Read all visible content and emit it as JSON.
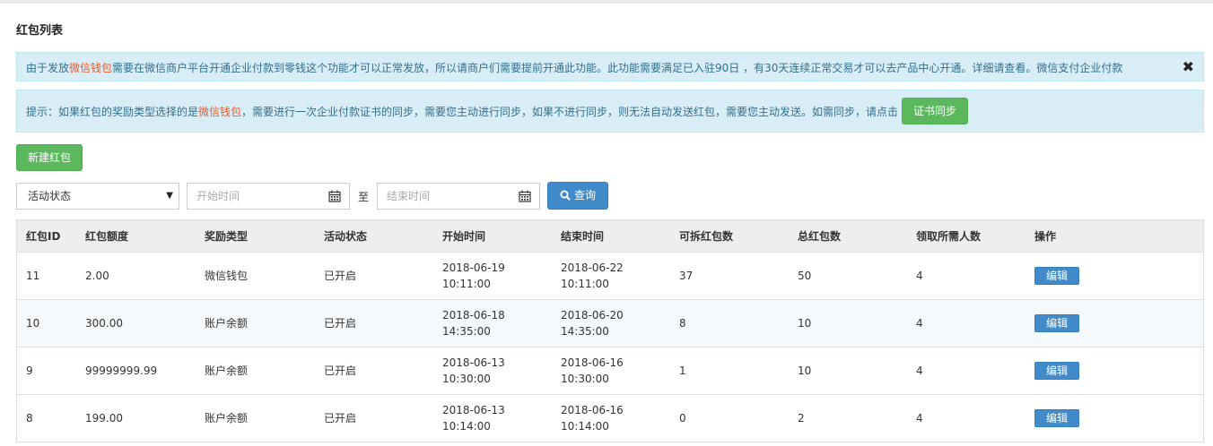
{
  "page_title": "红包列表",
  "alert1": {
    "prefix": "由于发放",
    "highlight": "微信钱包",
    "suffix": "需要在微信商户平台开通企业付款到零钱这个功能才可以正常发放，所以请商户们需要提前开通此功能。此功能需要满足已入驻90日 ，有30天连续正常交易才可以去产品中心开通。详细请查看。微信支付企业付款",
    "close": "✖"
  },
  "alert2": {
    "prefix": "提示：如果红包的奖励类型选择的是",
    "highlight": "微信钱包",
    "suffix": "，需要进行一次企业付款证书的同步，需要您主动进行同步，如果不进行同步，则无法自动发送红包，需要您主动发送。如需同步，请点击",
    "sync_button": "证书同步"
  },
  "new_button": "新建红包",
  "filters": {
    "status_select": "活动状态",
    "start_placeholder": "开始时间",
    "to_label": "至",
    "end_placeholder": "结束时间",
    "query_button": "查询"
  },
  "table": {
    "headers": [
      "红包ID",
      "红包额度",
      "奖励类型",
      "活动状态",
      "开始时间",
      "结束时间",
      "可拆红包数",
      "总红包数",
      "领取所需人数",
      "操作"
    ],
    "rows": [
      {
        "id": "11",
        "amount": "2.00",
        "type": "微信钱包",
        "status": "已开启",
        "start_date": "2018-06-19",
        "start_time": "10:11:00",
        "end_date": "2018-06-22",
        "end_time": "10:11:00",
        "available": "37",
        "total": "50",
        "required": "4",
        "action": "编辑"
      },
      {
        "id": "10",
        "amount": "300.00",
        "type": "账户余额",
        "status": "已开启",
        "start_date": "2018-06-18",
        "start_time": "14:35:00",
        "end_date": "2018-06-20",
        "end_time": "14:35:00",
        "available": "8",
        "total": "10",
        "required": "4",
        "action": "编辑"
      },
      {
        "id": "9",
        "amount": "99999999.99",
        "type": "账户余额",
        "status": "已开启",
        "start_date": "2018-06-13",
        "start_time": "10:30:00",
        "end_date": "2018-06-16",
        "end_time": "10:30:00",
        "available": "1",
        "total": "10",
        "required": "4",
        "action": "编辑"
      },
      {
        "id": "8",
        "amount": "199.00",
        "type": "账户余额",
        "status": "已开启",
        "start_date": "2018-06-13",
        "start_time": "10:14:00",
        "end_date": "2018-06-16",
        "end_time": "10:14:00",
        "available": "0",
        "total": "2",
        "required": "4",
        "action": "编辑"
      }
    ]
  },
  "colors": {
    "alert_bg": "#d9edf7",
    "highlight": "#f05a28",
    "primary": "#428bca",
    "success": "#5cb85c"
  },
  "icons": [
    "close-icon",
    "calendar-icon",
    "search-icon",
    "caret-down-icon"
  ]
}
